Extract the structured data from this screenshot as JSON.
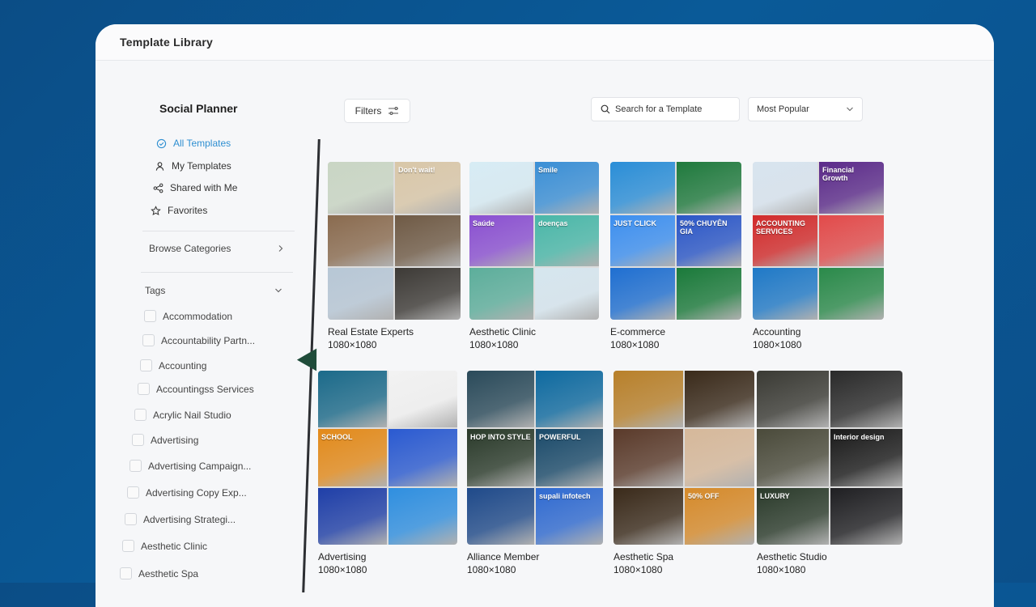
{
  "window": {
    "title": "Template Library"
  },
  "sidebar": {
    "heading": "Social Planner",
    "nav": [
      {
        "label": "All Templates",
        "icon": "check-circle-icon"
      },
      {
        "label": "My Templates",
        "icon": "user-icon"
      },
      {
        "label": "Shared with Me",
        "icon": "share-icon"
      },
      {
        "label": "Favorites",
        "icon": "star-icon"
      }
    ],
    "browse_label": "Browse Categories",
    "tags_label": "Tags",
    "tags": [
      "Accommodation",
      "Accountability Partn...",
      "Accounting",
      "Accountingss Services",
      "Acrylic Nail Studio",
      "Advertising",
      "Advertising Campaign...",
      "Advertising Copy Exp...",
      "Advertising Strategi...",
      "Aesthetic Clinic",
      "Aesthetic Spa"
    ]
  },
  "toolbar": {
    "filters_label": "Filters",
    "search_placeholder": "Search for a Template",
    "sort_value": "Most Popular"
  },
  "colors": {
    "accent": "#2f8fd1",
    "background": "#0b4d86"
  },
  "templates": [
    {
      "name": "Real Estate Experts",
      "size": "1080×1080",
      "tile_colors": [
        "#c9d6c4",
        "#d9c7a8",
        "#8a6b4f",
        "#6f5a45",
        "#b7c7d6",
        "#3d3a36"
      ],
      "tile_texts": [
        "",
        "Don't wait!",
        "",
        "",
        "",
        ""
      ]
    },
    {
      "name": "Aesthetic Clinic",
      "size": "1080×1080",
      "tile_colors": [
        "#d7ecf5",
        "#3a8fd6",
        "#8a4fd1",
        "#49b7a8",
        "#5cae9b",
        "#d6e6ef"
      ],
      "tile_texts": [
        "",
        "Smile",
        "Saúde",
        "doenças",
        "",
        ""
      ]
    },
    {
      "name": "E-commerce",
      "size": "1080×1080",
      "tile_colors": [
        "#2a8ed8",
        "#1f7a3d",
        "#3c8ff0",
        "#2a56c7",
        "#1f6fd1",
        "#1a7a3a"
      ],
      "tile_texts": [
        "",
        "",
        "JUST CLICK",
        "50% CHUYÊN GIA",
        "",
        ""
      ]
    },
    {
      "name": "Accounting",
      "size": "1080×1080",
      "tile_colors": [
        "#d8e4ef",
        "#5b2a8a",
        "#d22a2a",
        "#e24a4a",
        "#1f79c7",
        "#2a8a4a"
      ],
      "tile_texts": [
        "",
        "Financial Growth",
        "ACCOUNTING SERVICES",
        "",
        "",
        ""
      ]
    },
    {
      "name": "Advertising",
      "size": "1080×1080",
      "tile_colors": [
        "#1b6a8a",
        "#f2f2f2",
        "#e38a1a",
        "#2a5ad1",
        "#1f3fa8",
        "#2f8fe0"
      ],
      "tile_texts": [
        "",
        "",
        "SCHOOL",
        "",
        "",
        ""
      ]
    },
    {
      "name": "Alliance Member",
      "size": "1080×1080",
      "tile_colors": [
        "#2a4a5a",
        "#0e6aa0",
        "#2a3a2a",
        "#1a4a6a",
        "#1f4a8a",
        "#2f6ad1"
      ],
      "tile_texts": [
        "",
        "",
        "HOP INTO STYLE",
        "POWERFUL",
        "",
        "supali infotech"
      ]
    },
    {
      "name": "Aesthetic Spa",
      "size": "1080×1080",
      "tile_colors": [
        "#b8802a",
        "#3a2a1a",
        "#5a3a2a",
        "#d6b89a",
        "#3a2a1a",
        "#d68a2a"
      ],
      "tile_texts": [
        "",
        "",
        "",
        "",
        "",
        "50% OFF"
      ]
    },
    {
      "name": "Aesthetic Studio",
      "size": "1080×1080",
      "tile_colors": [
        "#3a3a34",
        "#2a2a2a",
        "#4a4a3a",
        "#1a1a1a",
        "#2a3a2a",
        "#1f1f22"
      ],
      "tile_texts": [
        "",
        "",
        "",
        "Interior design",
        "LUXURY",
        ""
      ]
    }
  ]
}
